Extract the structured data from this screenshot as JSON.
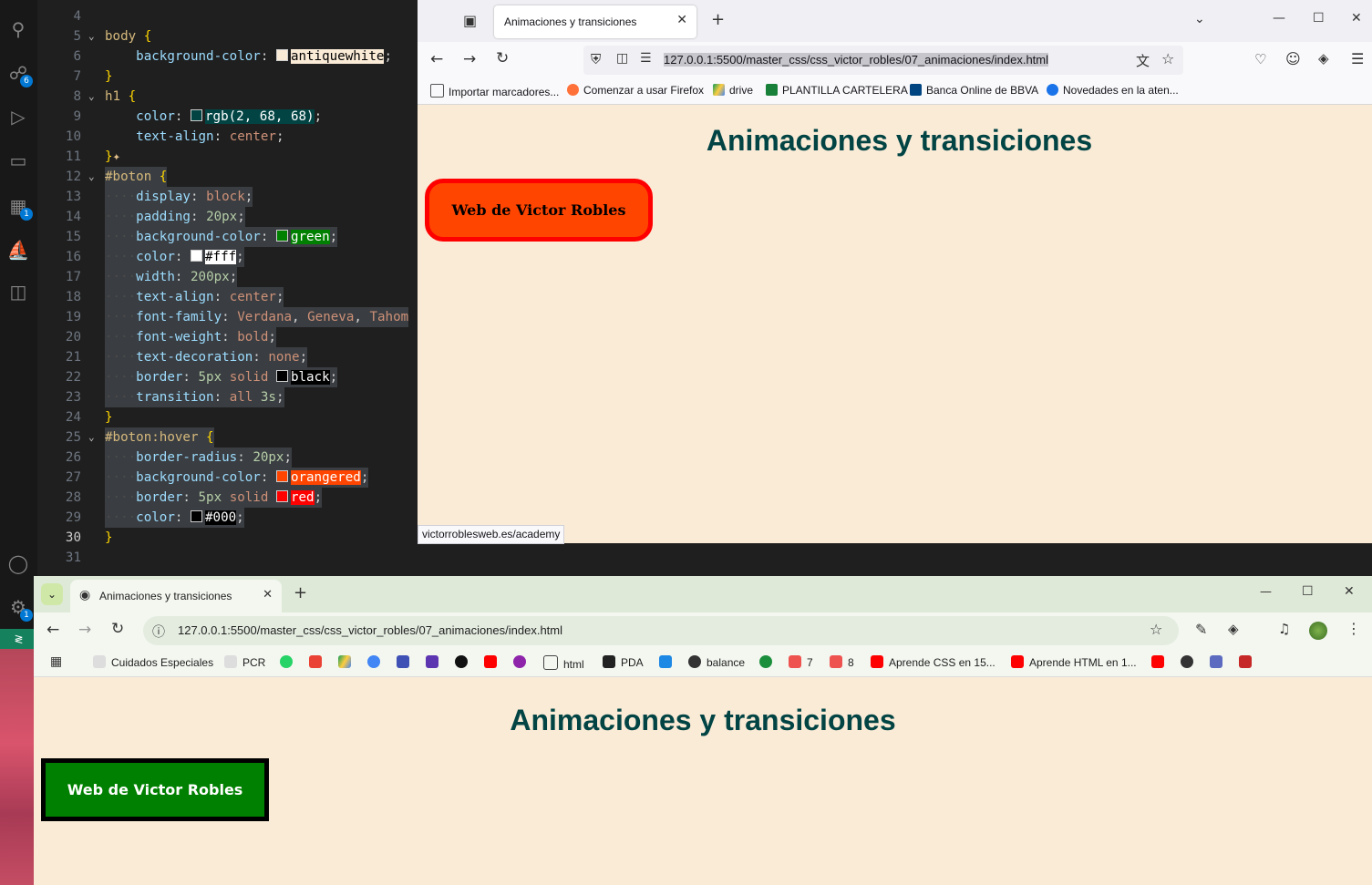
{
  "vscode": {
    "activity_badges": {
      "scm": "6",
      "extensions": "1",
      "settings": "1"
    },
    "code_lines": [
      {
        "n": "4",
        "t": ""
      },
      {
        "n": "5",
        "t": "body {"
      },
      {
        "n": "6",
        "t": "    background-color:  antiquewhite;"
      },
      {
        "n": "7",
        "t": "}"
      },
      {
        "n": "8",
        "t": "h1 {"
      },
      {
        "n": "9",
        "t": "    color:  rgb(2, 68, 68);"
      },
      {
        "n": "10",
        "t": "    text-align: center;"
      },
      {
        "n": "11",
        "t": "}"
      },
      {
        "n": "12",
        "t": "#boton {"
      },
      {
        "n": "13",
        "t": "    display: block;"
      },
      {
        "n": "14",
        "t": "    padding: 20px;"
      },
      {
        "n": "15",
        "t": "    background-color:  green;"
      },
      {
        "n": "16",
        "t": "    color:  #fff;"
      },
      {
        "n": "17",
        "t": "    width: 200px;"
      },
      {
        "n": "18",
        "t": "    text-align: center;"
      },
      {
        "n": "19",
        "t": "    font-family: Verdana, Geneva, Tahom"
      },
      {
        "n": "20",
        "t": "    font-weight: bold;"
      },
      {
        "n": "21",
        "t": "    text-decoration: none;"
      },
      {
        "n": "22",
        "t": "    border: 5px solid  black;"
      },
      {
        "n": "23",
        "t": "    transition: all 3s;"
      },
      {
        "n": "24",
        "t": "}"
      },
      {
        "n": "25",
        "t": "#boton:hover {"
      },
      {
        "n": "26",
        "t": "    border-radius: 20px;"
      },
      {
        "n": "27",
        "t": "    background-color:  orangered;"
      },
      {
        "n": "28",
        "t": "    border: 5px solid  red;"
      },
      {
        "n": "29",
        "t": "    color:  #000;"
      },
      {
        "n": "30",
        "t": "}"
      },
      {
        "n": "31",
        "t": ""
      }
    ]
  },
  "firefox": {
    "tab_title": "Animaciones y transiciones",
    "url": "127.0.0.1:5500/master_css/css_victor_robles/07_animaciones/index.html",
    "bookmarks": [
      "Importar marcadores...",
      "Comenzar a usar Firefox",
      "drive",
      "PLANTILLA CARTELERA",
      "Banca Online de BBVA",
      "Novedades en la aten..."
    ],
    "page_heading": "Animaciones y transiciones",
    "button_label": "Web de Victor Robles",
    "status_url": "victorroblesweb.es/academy"
  },
  "chrome": {
    "tab_title": "Animaciones y transiciones",
    "url": "127.0.0.1:5500/master_css/css_victor_robles/07_animaciones/index.html",
    "bookmarks": [
      "Cuidados Especiales",
      "PCR",
      "html",
      "PDA",
      "balance",
      "7",
      "8",
      "Aprende CSS en 15...",
      "Aprende HTML en 1..."
    ],
    "page_heading": "Animaciones y transiciones",
    "button_label": "Web de Victor Robles"
  },
  "colors": {
    "antiquewhite": "#faebd7",
    "heading": "#024444",
    "green": "#008000",
    "orangered": "#ff4500",
    "red": "#ff0000"
  }
}
